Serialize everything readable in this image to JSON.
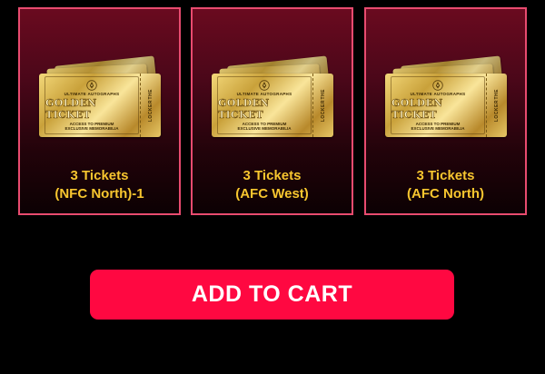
{
  "ticket_art": {
    "brand": "ULTIMATE AUTOGRAPHS",
    "headline": "GOLDEN TICKET",
    "sub_line1": "ACCESS TO PREMIUM",
    "sub_line2": "EXCLUSIVE MEMORABILIA",
    "stub_top": "THE",
    "stub_text": "LOCKER",
    "icon": "pen-nib-emblem-icon"
  },
  "products": [
    {
      "line1": "3 Tickets",
      "line2": "(NFC North)-1"
    },
    {
      "line1": "3 Tickets",
      "line2": "(AFC West)"
    },
    {
      "line1": "3 Tickets",
      "line2": "(AFC North)"
    }
  ],
  "add_to_cart_label": "ADD TO CART",
  "colors": {
    "background": "#000000",
    "card_border": "#e84b6f",
    "card_top": "#6a0a1f",
    "label": "#f7c62f",
    "cta": "#ff0841",
    "gold": "#d4ae4a"
  }
}
